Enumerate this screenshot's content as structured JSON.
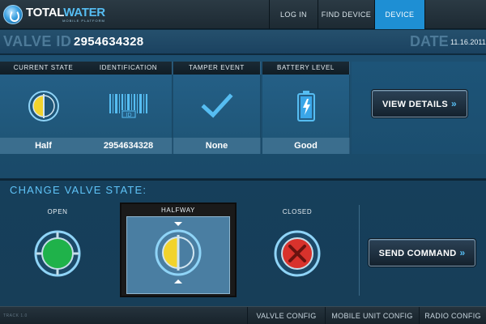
{
  "brand": {
    "name_part1": "TOTAL",
    "name_part2": "WATER",
    "tagline": "Mobile Platform"
  },
  "nav": {
    "login": "LOG IN",
    "find_device": "FIND DEVICE",
    "device": "DEVICE",
    "active": "device"
  },
  "valve": {
    "id_label": "VALVE ID",
    "id_value": "2954634328",
    "date_label": "DATE",
    "date_value": "11.16.2011"
  },
  "status": {
    "columns": [
      {
        "header": "CURRENT STATE",
        "value": "Half",
        "icon": "half-valve-icon"
      },
      {
        "header": "IDENTIFICATION",
        "value": "2954634328",
        "icon": "barcode-icon"
      },
      {
        "header": "TAMPER EVENT",
        "value": "None",
        "icon": "checkmark-icon"
      },
      {
        "header": "BATTERY LEVEL",
        "value": "Good",
        "icon": "battery-icon"
      }
    ],
    "view_details_label": "VIEW DETAILS"
  },
  "change_state": {
    "title": "CHANGE VALVE STATE:",
    "options": [
      {
        "label": "OPEN",
        "icon": "open-valve-icon"
      },
      {
        "label": "HALFWAY",
        "icon": "half-valve-icon",
        "selected": true
      },
      {
        "label": "CLOSED",
        "icon": "closed-valve-icon"
      }
    ],
    "send_label": "SEND COMMAND"
  },
  "footer": {
    "note": "TRACK 1.0",
    "items": [
      "VALVLE CONFIG",
      "MOBILE UNIT CONFIG",
      "RADIO CONFIG"
    ]
  },
  "colors": {
    "accent": "#56bdf2",
    "active_tab": "#1e8fd4",
    "open_green": "#1fb24a",
    "closed_red": "#d8322c",
    "half_yellow": "#f2d32c"
  }
}
